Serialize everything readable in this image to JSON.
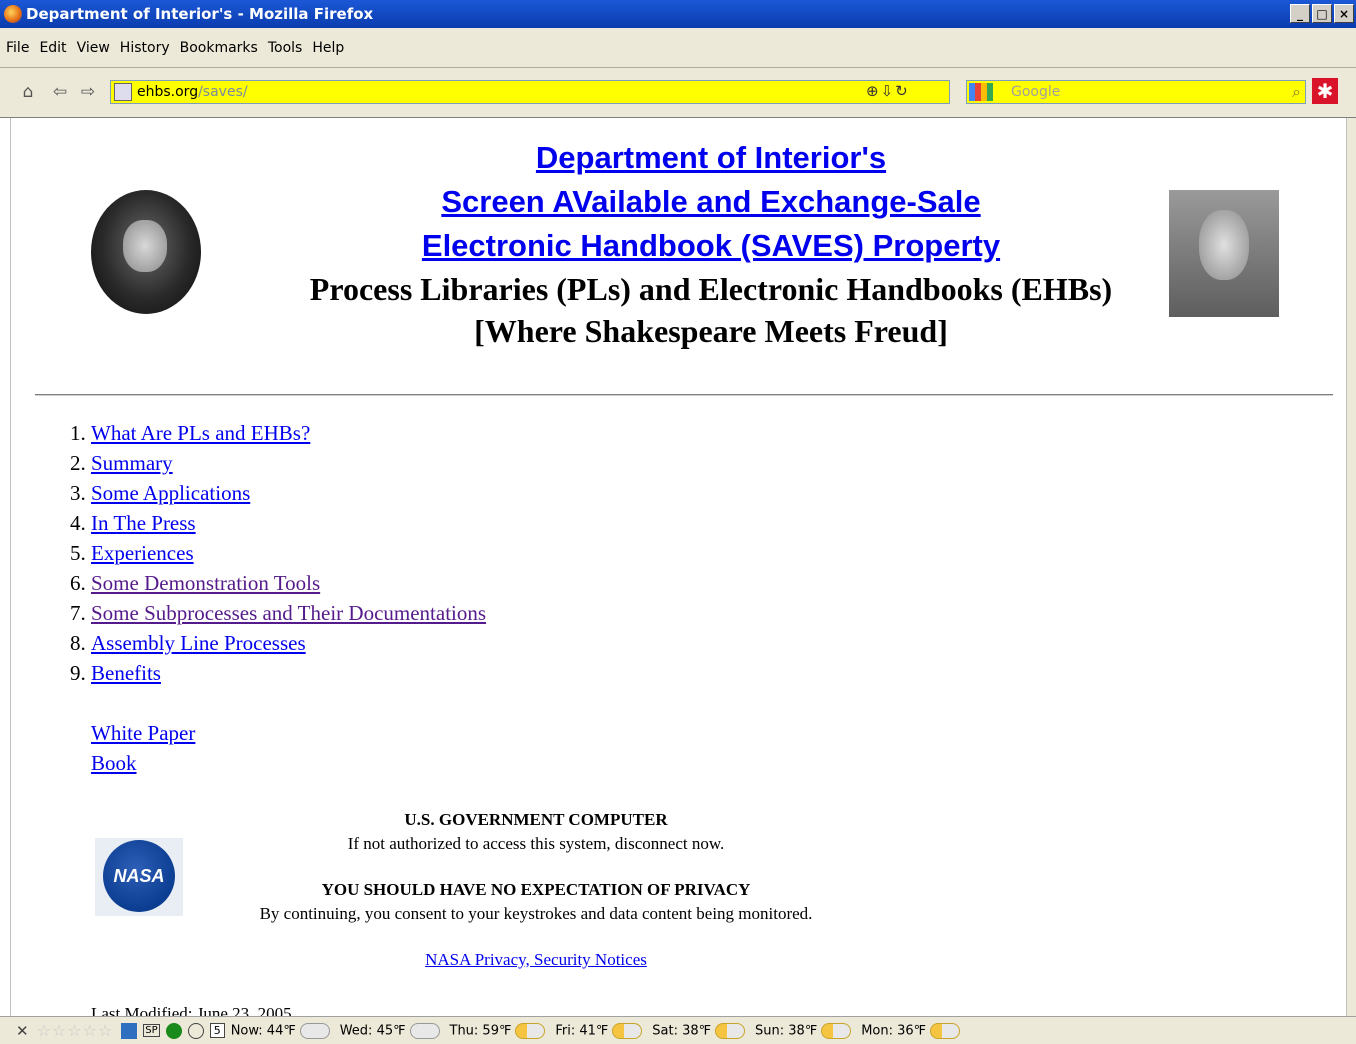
{
  "window": {
    "title": "Department of Interior's - Mozilla Firefox",
    "minimize": "_",
    "maximize": "□",
    "close": "×"
  },
  "menu": [
    "File",
    "Edit",
    "View",
    "History",
    "Bookmarks",
    "Tools",
    "Help"
  ],
  "url": {
    "host": "ehbs.org",
    "path": "/saves/"
  },
  "search": {
    "placeholder": "Google"
  },
  "page": {
    "heading_lines": [
      "Department of Interior's",
      "Screen AVailable and Exchange-Sale",
      "Electronic Handbook (SAVES) Property"
    ],
    "subheading_lines": [
      "Process Libraries (PLs) and Electronic Handbooks (EHBs)",
      "[Where Shakespeare Meets Freud]"
    ],
    "toc": [
      {
        "label": "What Are PLs and EHBs?",
        "visited": false
      },
      {
        "label": "Summary",
        "visited": false
      },
      {
        "label": "Some Applications",
        "visited": false
      },
      {
        "label": "In The Press",
        "visited": false
      },
      {
        "label": "Experiences",
        "visited": false
      },
      {
        "label": "Some Demonstration Tools",
        "visited": true
      },
      {
        "label": "Some Subprocesses and Their Documentations",
        "visited": true
      },
      {
        "label": "Assembly Line Processes",
        "visited": false
      },
      {
        "label": "Benefits",
        "visited": false
      }
    ],
    "extra_links": [
      "White Paper",
      "Book"
    ],
    "logo_text": "NASA",
    "notice": {
      "title1": "U.S. GOVERNMENT COMPUTER",
      "line1": "If not authorized to access this system, disconnect now.",
      "title2": "YOU SHOULD HAVE NO EXPECTATION OF PRIVACY",
      "line2": "By continuing, you consent to your keystrokes and data content being monitored.",
      "link": "NASA Privacy, Security Notices"
    },
    "last_modified": "Last Modified: June 23, 2005"
  },
  "statusbar": {
    "sp_label": "SP",
    "calendar_day": "5",
    "weather": [
      {
        "label": "Now: 44℉",
        "icon": "cloud"
      },
      {
        "label": "Wed: 45℉",
        "icon": "cloud"
      },
      {
        "label": "Thu: 59℉",
        "icon": "sun"
      },
      {
        "label": "Fri: 41℉",
        "icon": "sun"
      },
      {
        "label": "Sat: 38℉",
        "icon": "sun"
      },
      {
        "label": "Sun: 38℉",
        "icon": "sun"
      },
      {
        "label": "Mon: 36℉",
        "icon": "sun"
      }
    ]
  }
}
